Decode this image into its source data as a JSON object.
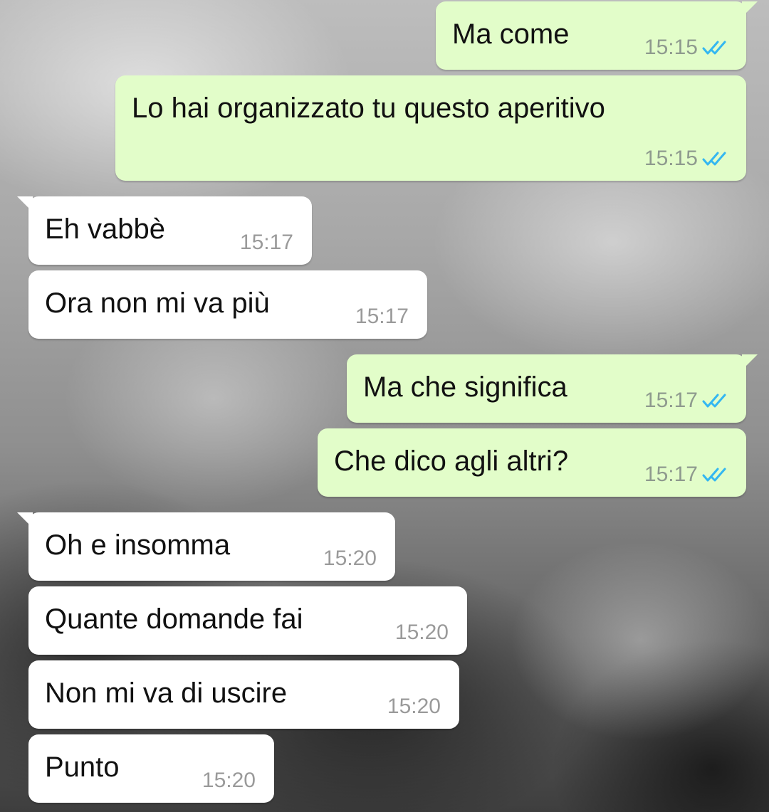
{
  "colors": {
    "outgoing_bubble": "#e2fdc9",
    "incoming_bubble": "#ffffff",
    "read_ticks": "#34b7f1"
  },
  "icons": {
    "read_receipt": "double-check-icon"
  },
  "messages": [
    {
      "direction": "outgoing",
      "text": "Ma come",
      "time": "15:15",
      "status": "read"
    },
    {
      "direction": "outgoing",
      "text": "Lo hai organizzato tu questo aperitivo",
      "time": "15:15",
      "status": "read"
    },
    {
      "direction": "incoming",
      "text": "Eh vabbè",
      "time": "15:17"
    },
    {
      "direction": "incoming",
      "text": "Ora non mi va più",
      "time": "15:17"
    },
    {
      "direction": "outgoing",
      "text": "Ma che significa",
      "time": "15:17",
      "status": "read"
    },
    {
      "direction": "outgoing",
      "text": "Che dico agli altri?",
      "time": "15:17",
      "status": "read"
    },
    {
      "direction": "incoming",
      "text": "Oh e insomma",
      "time": "15:20"
    },
    {
      "direction": "incoming",
      "text": "Quante domande fai",
      "time": "15:20"
    },
    {
      "direction": "incoming",
      "text": "Non mi va di uscire",
      "time": "15:20"
    },
    {
      "direction": "incoming",
      "text": "Punto",
      "time": "15:20"
    }
  ]
}
